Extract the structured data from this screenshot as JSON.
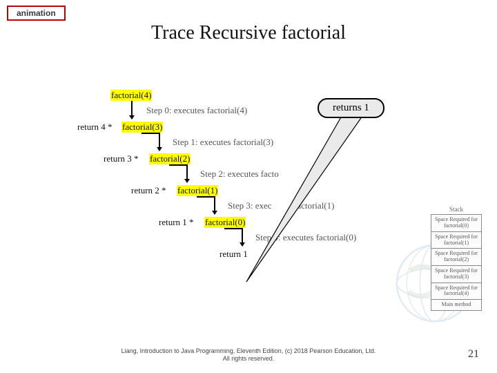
{
  "badge": "animation",
  "title": "Trace Recursive factorial",
  "callout": "returns 1",
  "nodes": {
    "f4": "factorial(4)",
    "step0": "Step 0: executes factorial(4)",
    "r4": "return 4 * ",
    "f3": "factorial(3)",
    "step1": "Step 1: executes factorial(3)",
    "r3": "return 3 * ",
    "f2": "factorial(2)",
    "step2": "Step 2: executes facto",
    "r2": "return 2 * ",
    "f1": "factorial(1)",
    "step3": "Step 3: exec",
    "step3b": "factorial(1)",
    "r1": "return 1 * ",
    "f0": "factorial(0)",
    "step4": "Step 4: executes factorial(0)",
    "rfinal": "return 1"
  },
  "stack": {
    "label": "Stack",
    "cells": [
      "Space Required for factorial(0)",
      "Space Required for factorial(1)",
      "Space Required for factorial(2)",
      "Space Required for factorial(3)",
      "Space Required for factorial(4)",
      "Main method"
    ]
  },
  "footer_line1": "Liang, Introduction to Java Programming, Eleventh Edition, (c) 2018 Pearson Education, Ltd.",
  "footer_line2": "All rights reserved.",
  "page": "21"
}
